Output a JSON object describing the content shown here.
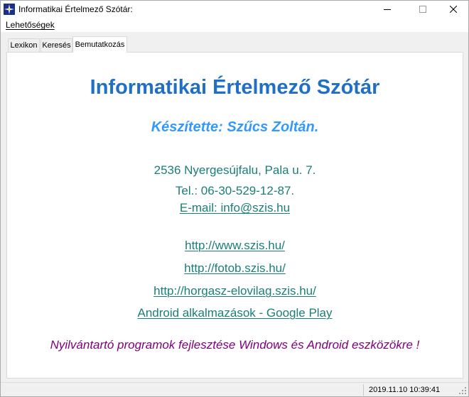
{
  "window": {
    "title": "Informatikai Értelmező Szótár:"
  },
  "menu": {
    "items": [
      {
        "label": "Lehetőségek"
      }
    ]
  },
  "tabs": [
    {
      "label": "Lexikon",
      "active": false
    },
    {
      "label": "Keresés",
      "active": false
    },
    {
      "label": "Bemutatkozás",
      "active": true
    }
  ],
  "about": {
    "heading": "Informatikai Értelmező Szótár",
    "author": "Készítette: Szűcs Zoltán.",
    "address": "2536 Nyergesújfalu, Pala u. 7.",
    "phone": "Tel.: 06-30-529-12-87.",
    "email": "E-mail: info@szis.hu",
    "links": [
      "http://www.szis.hu/",
      "http://fotob.szis.hu/",
      "http://horgasz-elovilag.szis.hu/",
      "Android alkalmazások - Google Play "
    ],
    "slogan": "Nyilvántartó programok fejlesztése Windows és Android eszközökre !"
  },
  "status": {
    "datetime": "2019.11.10 10:39:41"
  },
  "colors": {
    "heading": "#1f6ec8",
    "author": "#3399ff",
    "contact": "#1a7f78",
    "slogan": "#800080"
  },
  "icons": {
    "app": "dictionary-app-icon",
    "minimize": "minimize-icon",
    "maximize": "maximize-icon",
    "close": "close-icon",
    "grip": "resize-grip-icon"
  }
}
